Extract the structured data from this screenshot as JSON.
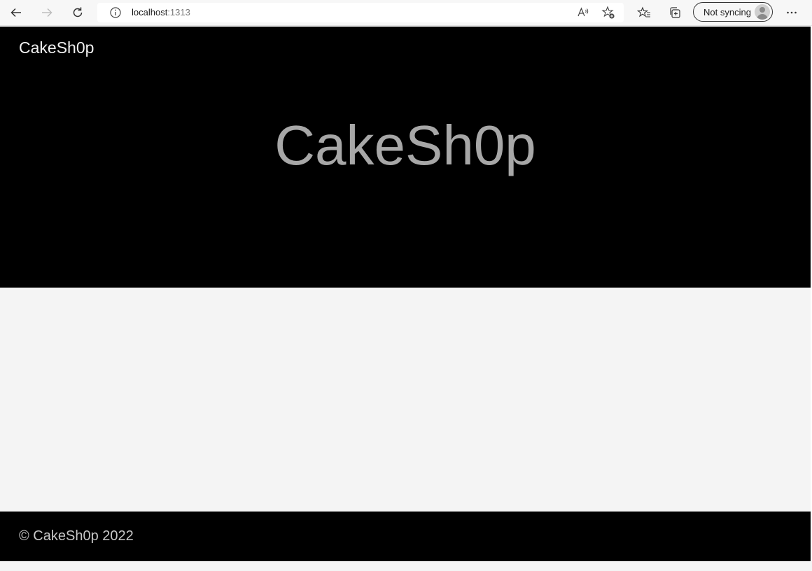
{
  "browser": {
    "url_host": "localhost",
    "url_port": ":1313",
    "sync_label": "Not syncing",
    "icons": {
      "back": "arrow-left-icon",
      "forward": "arrow-right-icon",
      "refresh": "refresh-icon",
      "site_info": "info-icon",
      "read_aloud": "read-aloud-icon",
      "add_favorite": "star-add-icon",
      "favorites": "favorites-icon",
      "collections": "collections-icon",
      "profile": "profile-icon",
      "more": "more-icon"
    }
  },
  "site": {
    "brand": "CakeSh0p",
    "hero_title": "CakeSh0p",
    "footer_text": "© CakeSh0p 2022"
  },
  "colors": {
    "header_bg": "#000000",
    "page_bg": "#f4f4f4",
    "hero_text": "#a7a7a7",
    "brand_text": "#f0f0f0"
  }
}
